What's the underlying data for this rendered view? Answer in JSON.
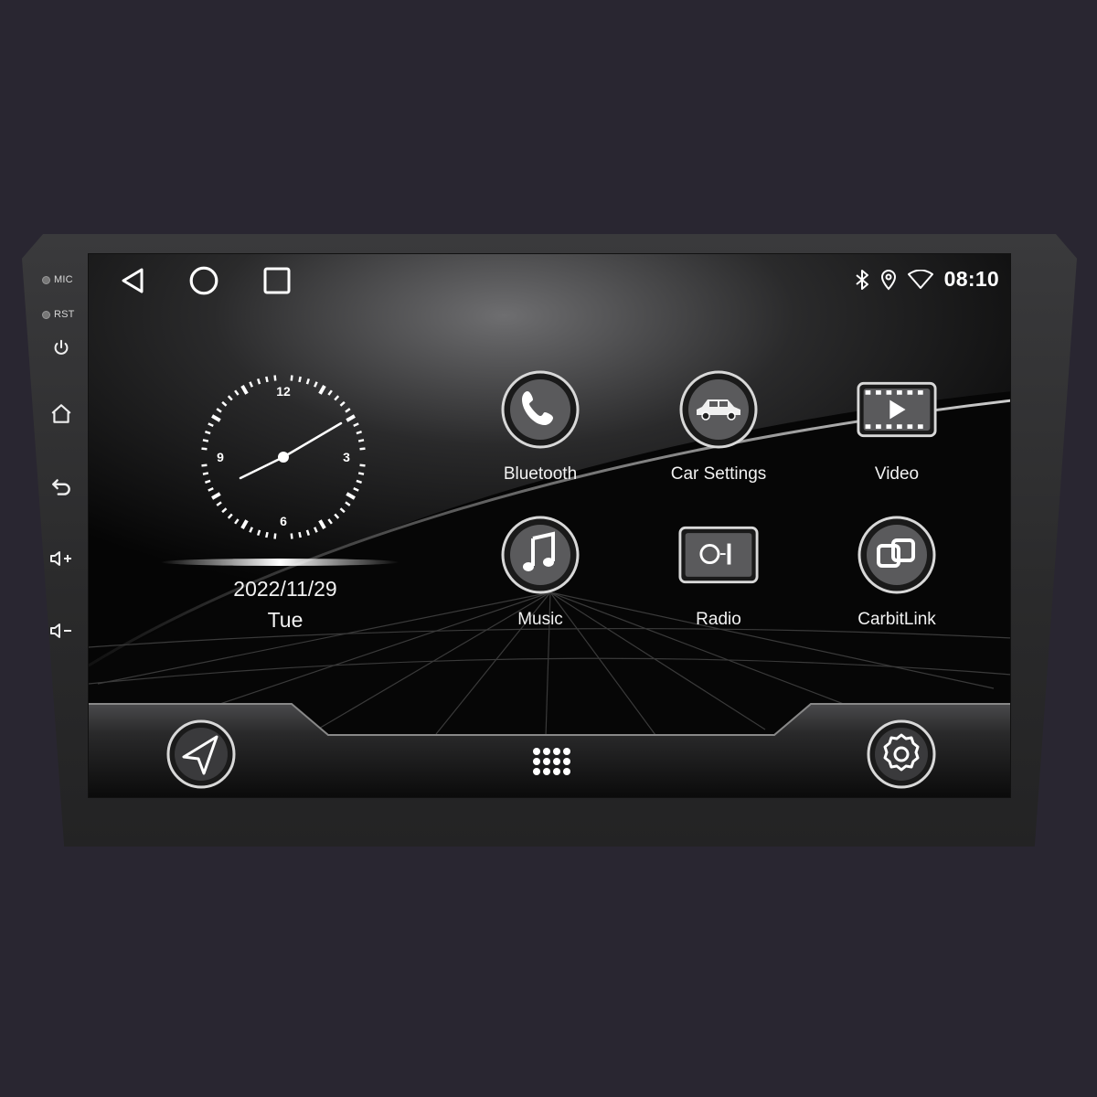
{
  "side": {
    "mic_label": "MIC",
    "rst_label": "RST"
  },
  "status": {
    "time": "08:10"
  },
  "widget": {
    "clock_numbers": [
      "12",
      "3",
      "6",
      "9"
    ],
    "date": "2022/11/29",
    "day": "Tue"
  },
  "apps": [
    {
      "label": "Bluetooth",
      "icon": "phone-icon"
    },
    {
      "label": "Car Settings",
      "icon": "car-icon"
    },
    {
      "label": "Video",
      "icon": "video-icon"
    },
    {
      "label": "Music",
      "icon": "music-icon"
    },
    {
      "label": "Radio",
      "icon": "radio-icon"
    },
    {
      "label": "CarbitLink",
      "icon": "link-icon"
    }
  ],
  "dock": {
    "left_icon": "navigation-icon",
    "center_icon": "app-drawer-icon",
    "right_icon": "settings-icon"
  },
  "colors": {
    "background": "#292631",
    "bezel": "#2e2e30",
    "screen": "#050505",
    "text": "#f2f2f2"
  }
}
